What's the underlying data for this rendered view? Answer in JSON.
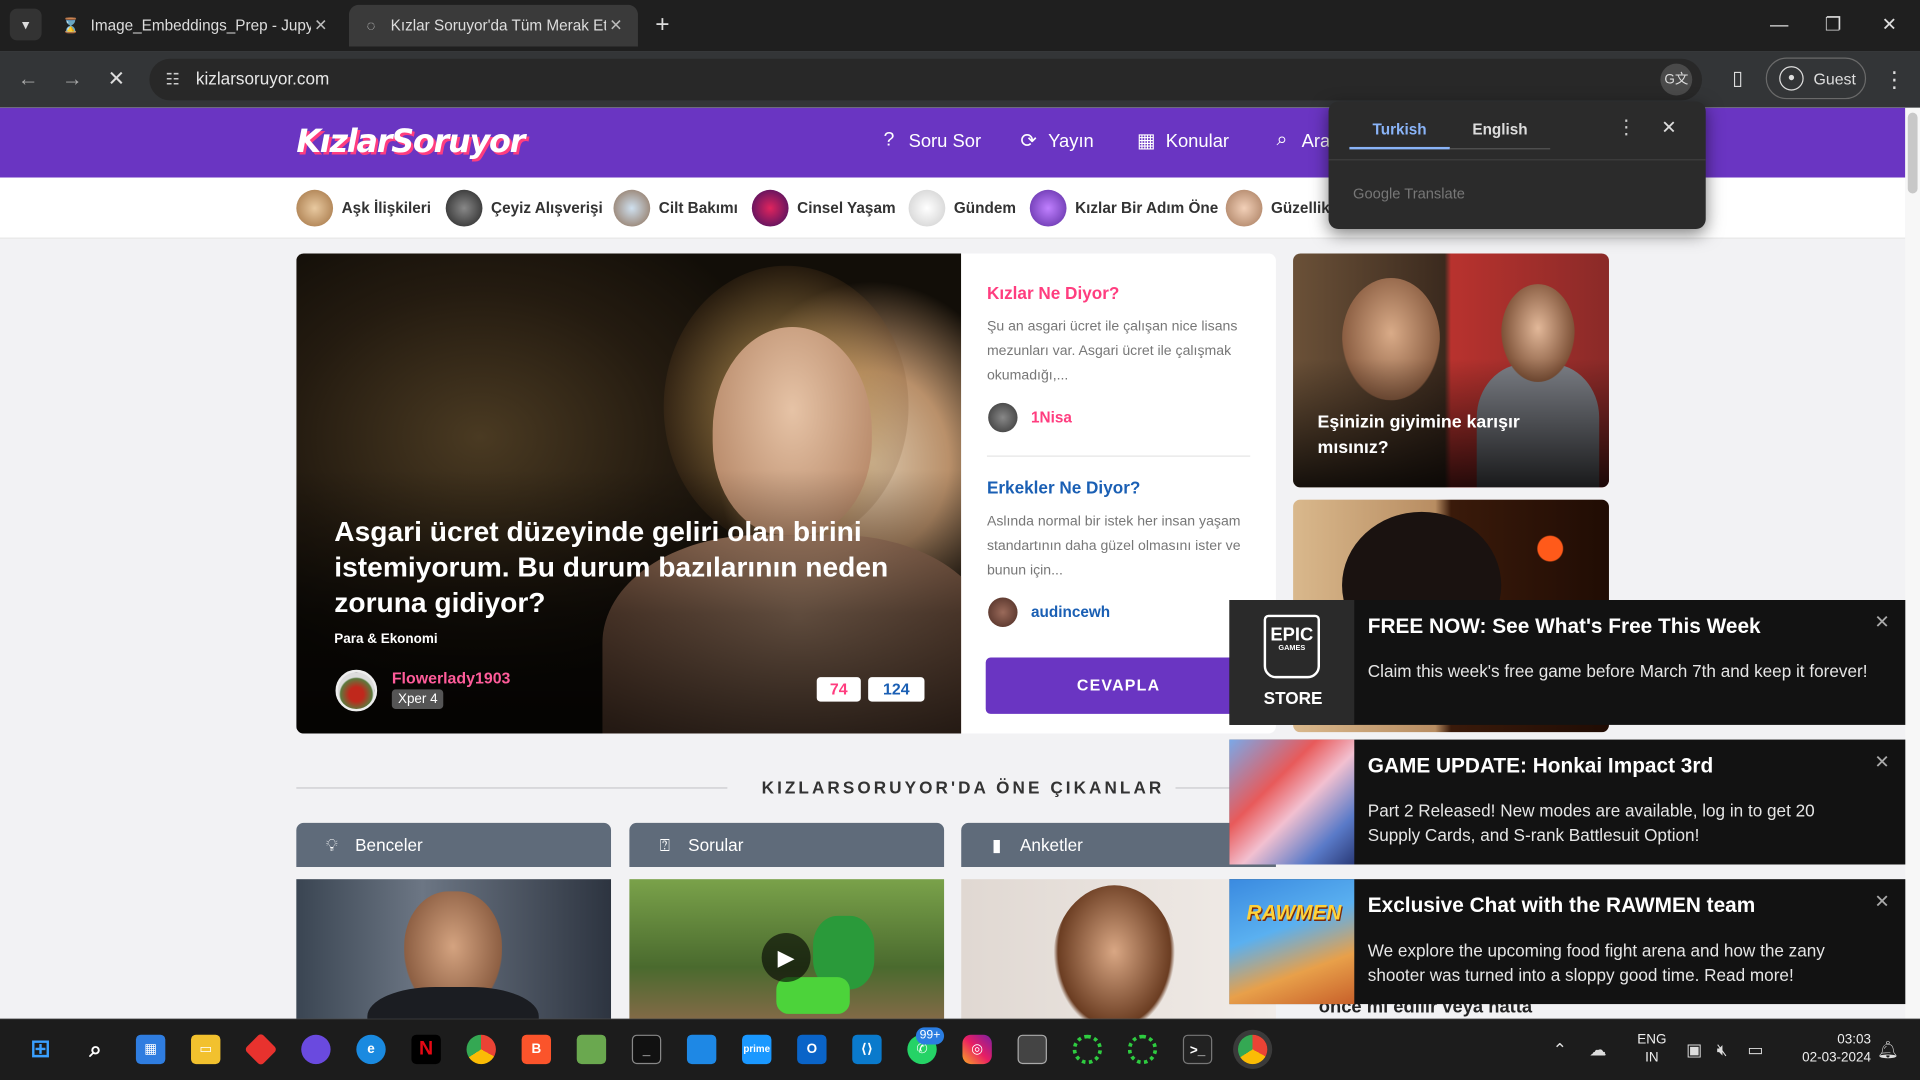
{
  "browser": {
    "tabs": [
      {
        "title": "Image_Embeddings_Prep - Jupy",
        "icon": "hourglass-icon"
      },
      {
        "title": "Kızlar Soruyor'da Tüm Merak Et",
        "icon": "loading-icon"
      }
    ],
    "url": "kizlarsoruyor.com",
    "profile_label": "Guest"
  },
  "translate_popup": {
    "tabs": [
      "Turkish",
      "English"
    ],
    "active_tab": "Turkish",
    "brand": "Google Translate"
  },
  "site": {
    "logo": "KızlarSoruyor",
    "nav": [
      "Soru Sor",
      "Yayın",
      "Konular",
      "Ara"
    ],
    "categories": [
      "Aşk İlişkileri",
      "Çeyiz Alışverişi",
      "Cilt Bakımı",
      "Cinsel Yaşam",
      "Gündem",
      "Kızlar Bir Adım Öne",
      "Güzellik"
    ],
    "colors": {
      "brand_purple": "#6a35c2",
      "pink": "#ff3d7f",
      "blue": "#1a5fb4"
    }
  },
  "hero": {
    "title": "Asgari ücret düzeyinde geliri olan birini istemiyorum. Bu durum bazılarının neden zoruna gidiyor?",
    "category": "Para & Ekonomi",
    "user": "Flowerlady1903",
    "badge": "Xper 4",
    "count_pink": "74",
    "count_blue": "124"
  },
  "side": {
    "kizlar_head": "Kızlar Ne Diyor?",
    "kizlar_text": "Şu an asgari ücret ile çalışan nice lisans mezunları var. Asgari ücret ile çalışmak okumadığı,...",
    "kizlar_user": "1Nisa",
    "erkekler_head": "Erkekler Ne Diyor?",
    "erkekler_text": "Aslında normal bir istek her insan yaşam standartının daha güzel olmasını ister ve bunun için...",
    "erkekler_user": "audincewh",
    "cta": "CEVAPLA"
  },
  "right_cards": [
    {
      "title": "Eşinizin giyimine karışır mısınız?"
    },
    {
      "title": "önce mi edilir veya hatta"
    }
  ],
  "featured": {
    "title": "KIZLARSORUYOR'DA ÖNE ÇIKANLAR",
    "columns": [
      "Benceler",
      "Sorular",
      "Anketler"
    ]
  },
  "notifications": [
    {
      "title": "FREE NOW: See What's Free This Week",
      "body": "Claim this week's free game before March 7th and keep it forever!",
      "image": "epic-games-store-logo",
      "logo_top": "EPIC",
      "logo_sub": "GAMES",
      "logo_bottom": "STORE"
    },
    {
      "title": "GAME UPDATE: Honkai Impact 3rd",
      "body": "Part 2 Released! New modes are available, log in to get 20 Supply Cards, and S-rank Battlesuit Option!",
      "image": "honkai-impact-art"
    },
    {
      "title": "Exclusive Chat with the RAWMEN team",
      "body": "We explore the upcoming food fight arena and how the zany shooter was turned into a sloppy good time. Read more!",
      "image": "rawmen-art",
      "image_text": "RAWMEN"
    }
  ],
  "taskbar": {
    "whatsapp_badge": "99+",
    "lang_top": "ENG",
    "lang_bottom": "IN",
    "time": "03:03",
    "date": "02-03-2024"
  }
}
